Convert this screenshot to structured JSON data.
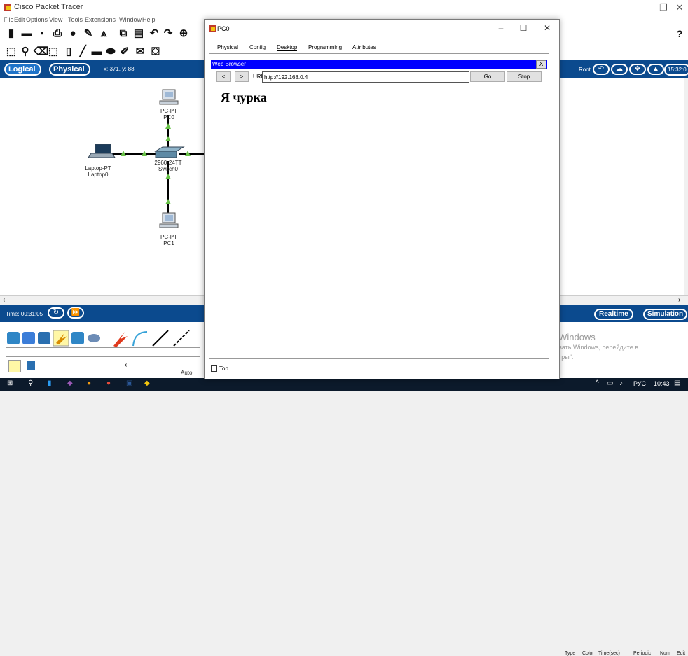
{
  "app": {
    "title": "Cisco Packet Tracer",
    "menu": [
      "File",
      "Edit",
      "Options",
      "View",
      "Tools",
      "Extensions",
      "Window",
      "Help"
    ]
  },
  "workspace": {
    "logical_label": "Logical",
    "physical_label": "Physical",
    "coords": "x: 371, y: 88",
    "root_label": "Root",
    "clock": "15:32:0",
    "devices": [
      {
        "name": "pc0",
        "model": "PC-PT",
        "label": "PC0"
      },
      {
        "name": "switch0",
        "model": "2960-24TT",
        "label": "Switch0"
      },
      {
        "name": "laptop0",
        "model": "Laptop-PT",
        "label": "Laptop0"
      },
      {
        "name": "pc1",
        "model": "PC-PT",
        "label": "PC1"
      }
    ]
  },
  "timebar": {
    "time": "Time: 00:31:05",
    "realtime": "Realtime",
    "simulation": "Simulation"
  },
  "pdu_columns": [
    "Type",
    "Color",
    "Time(sec)",
    "Periodic",
    "Num",
    "Edit"
  ],
  "bottom": {
    "auto_label": "Auto"
  },
  "pc_window": {
    "title": "PC0",
    "tabs": [
      "Physical",
      "Config",
      "Desktop",
      "Programming",
      "Attributes"
    ],
    "active_tab": "Desktop",
    "browser": {
      "title": "Web Browser",
      "close": "X",
      "back": "<",
      "forward": ">",
      "url_label": "URL",
      "url": "http://192.168.0.4",
      "go": "Go",
      "stop": "Stop",
      "page_heading": "Я чурка"
    },
    "top_checkbox": "Top"
  },
  "watermark": {
    "line1": "Активация Windows",
    "line2": "Чтобы активировать Windows, перейдите в",
    "line3": "раздел \"Параметры\"."
  },
  "taskbar": {
    "lang": "РУС",
    "time": "10:43"
  },
  "colors": {
    "accent_blue": "#0b4a8e",
    "browser_bar": "#0000ff",
    "link_green": "#6ac24a"
  }
}
